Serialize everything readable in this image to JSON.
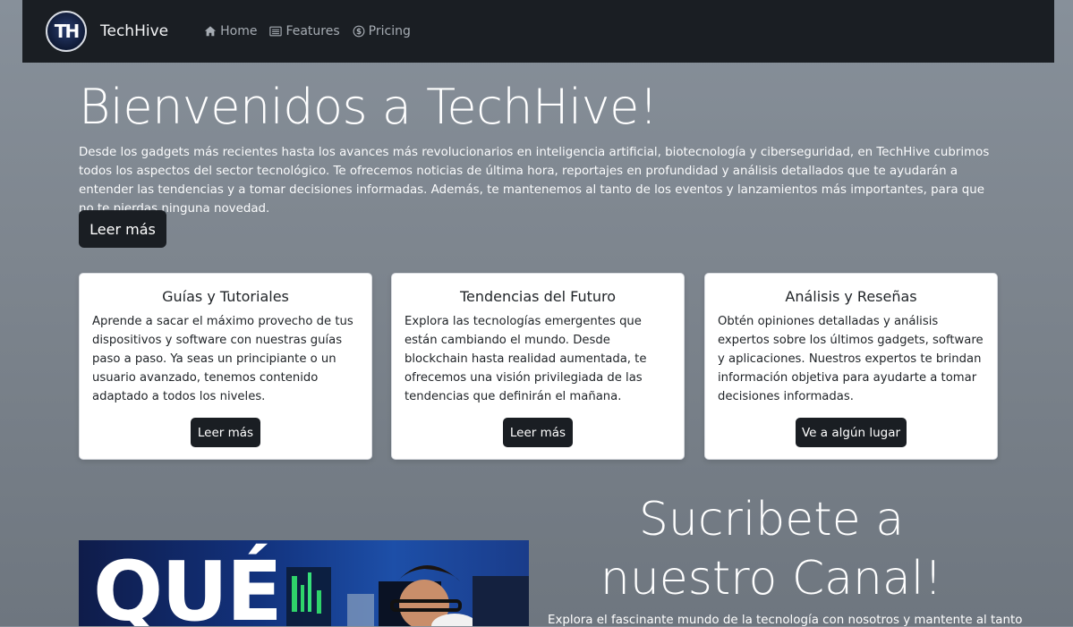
{
  "navbar": {
    "logo_text": "TH",
    "brand": "TechHive",
    "links": [
      {
        "label": "Home",
        "icon": "house-icon"
      },
      {
        "label": "Features",
        "icon": "list-icon"
      },
      {
        "label": "Pricing",
        "icon": "dollar-circle-icon"
      }
    ]
  },
  "hero": {
    "title": "Bienvenidos a TechHive!",
    "text": "Desde los gadgets más recientes hasta los avances más revolucionarios en inteligencia artificial, biotecnología y ciberseguridad, en TechHive cubrimos todos los aspectos del sector tecnológico. Te ofrecemos noticias de última hora, reportajes en profundidad y análisis detallados que te ayudarán a entender las tendencias y a tomar decisiones informadas. Además, te mantenemos al tanto de los eventos y lanzamientos más importantes, para que no te pierdas ninguna novedad.",
    "button": "Leer más"
  },
  "cards": [
    {
      "title": "Guías y Tutoriales",
      "text": "Aprende a sacar el máximo provecho de tus dispositivos y software con nuestras guías paso a paso. Ya seas un principiante o un usuario avanzado, tenemos contenido adaptado a todos los niveles.",
      "button": "Leer más"
    },
    {
      "title": "Tendencias del Futuro",
      "text": "Explora las tecnologías emergentes que están cambiando el mundo. Desde blockchain hasta realidad aumentada, te ofrecemos una visión privilegiada de las tendencias que definirán el mañana.",
      "button": "Leer más"
    },
    {
      "title": "Análisis y Reseñas",
      "text": "Obtén opiniones detalladas y análisis expertos sobre los últimos gadgets, software y aplicaciones. Nuestros expertos te brindan información objetiva para ayudarte a tomar decisiones informadas.",
      "button": "Ve a algún lugar"
    }
  ],
  "video": {
    "overlay_text": "QUÉ"
  },
  "subscribe": {
    "title": "Sucribete a nuestro Canal!",
    "text": "Explora el fascinante mundo de la tecnología con nosotros y mantente al tanto"
  },
  "colors": {
    "navbar": "#1a1e23",
    "background": "#7f8790",
    "button": "#1a1e23"
  }
}
